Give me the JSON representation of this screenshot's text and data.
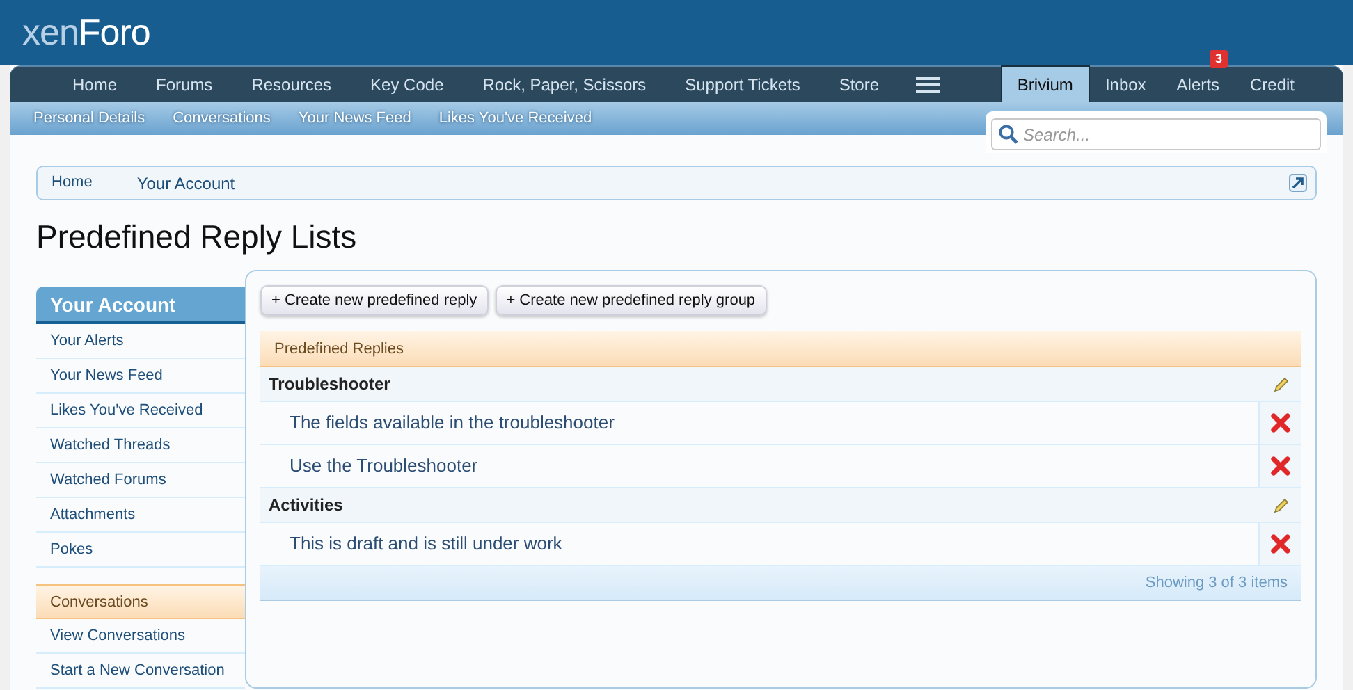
{
  "logo": {
    "prefix": "xen",
    "name": "Foro"
  },
  "nav": [
    {
      "label": "Home",
      "kind": "link",
      "selected": false
    },
    {
      "label": "Forums",
      "kind": "link",
      "selected": false
    },
    {
      "label": "Resources",
      "kind": "link",
      "selected": false
    },
    {
      "label": "Key Code",
      "kind": "link",
      "selected": false
    },
    {
      "label": "Rock, Paper, Scissors",
      "kind": "link",
      "selected": false
    },
    {
      "label": "Support Tickets",
      "kind": "link",
      "selected": false
    },
    {
      "label": "Store",
      "kind": "link",
      "selected": false
    },
    {
      "kind": "menu",
      "selected": false
    }
  ],
  "user_nav": [
    {
      "label": "Brivium",
      "selected": true
    },
    {
      "label": "Inbox",
      "selected": false
    },
    {
      "label": "Alerts",
      "selected": false,
      "badge": "3"
    },
    {
      "label": "Credit",
      "selected": false
    }
  ],
  "sub_nav": [
    "Personal Details",
    "Conversations",
    "Your News Feed",
    "Likes You've Received"
  ],
  "search": {
    "placeholder": "Search..."
  },
  "breadcrumb": [
    "Home",
    "Your Account"
  ],
  "title": "Predefined Reply Lists",
  "sidebar": [
    {
      "kind": "primary",
      "title": "Your Account",
      "items": [
        "Your Alerts",
        "Your News Feed",
        "Likes You've Received",
        "Watched Threads",
        "Watched Forums",
        "Attachments",
        "Pokes"
      ]
    },
    {
      "kind": "secondary",
      "title": "Conversations",
      "items": [
        "View Conversations",
        "Start a New Conversation"
      ]
    }
  ],
  "buttons": [
    "+ Create new predefined reply",
    "+ Create new predefined reply group"
  ],
  "table": {
    "header": "Predefined Replies",
    "groups": [
      {
        "title": "Troubleshooter",
        "replies": [
          "The fields available in the troubleshooter",
          "Use the Troubleshooter"
        ]
      },
      {
        "title": "Activities",
        "replies": [
          "This is draft and is still under work"
        ]
      }
    ],
    "footer": "Showing 3 of 3 items"
  }
}
